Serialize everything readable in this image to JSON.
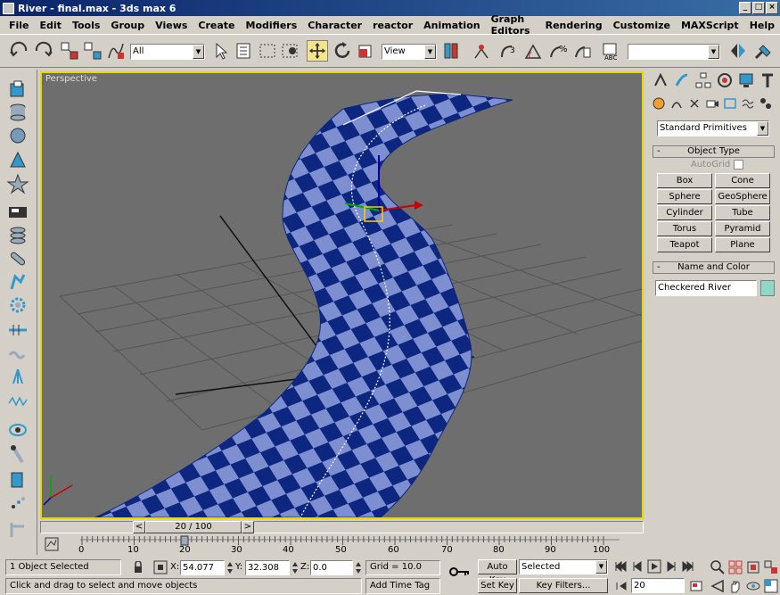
{
  "window": {
    "title": "River - final.max - 3ds max 6"
  },
  "menu": [
    "File",
    "Edit",
    "Tools",
    "Group",
    "Views",
    "Create",
    "Modifiers",
    "Character",
    "reactor",
    "Animation",
    "Graph Editors",
    "Rendering",
    "Customize",
    "MAXScript",
    "Help"
  ],
  "toolbar": {
    "selection_filter": "All",
    "ref_coord": "View",
    "named_selection": ""
  },
  "viewport": {
    "label": "Perspective"
  },
  "command_panel": {
    "category_dropdown": "Standard Primitives",
    "object_type": {
      "header": "Object Type",
      "autogrid_label": "AutoGrid",
      "buttons": [
        "Box",
        "Cone",
        "Sphere",
        "GeoSphere",
        "Cylinder",
        "Tube",
        "Torus",
        "Pyramid",
        "Teapot",
        "Plane"
      ]
    },
    "name_color": {
      "header": "Name and Color",
      "object_name": "Checkered River",
      "object_color": "#8fd8c8"
    }
  },
  "time_slider": {
    "label": "20 / 100",
    "frame": 20,
    "max": 100
  },
  "trackbar": {
    "ticks": [
      "0",
      "10",
      "20",
      "30",
      "40",
      "50",
      "60",
      "70",
      "80",
      "90",
      "100"
    ]
  },
  "status": {
    "selection": "1 Object Selected",
    "prompt": "Click and drag to select and move objects",
    "x_label": "X:",
    "x_value": "54.077",
    "y_label": "Y:",
    "y_value": "32.308",
    "z_label": "Z:",
    "z_value": "0.0",
    "grid": "Grid = 10.0",
    "add_time_tag": "Add Time Tag",
    "auto_key": "Auto Key",
    "set_key": "Set Key",
    "key_mode": "Selected",
    "key_filters": "Key Filters...",
    "current_frame": "20"
  },
  "colors": {
    "viewport_bg": "#6e6e6e",
    "active_border": "#e8d800",
    "checker_dark": "#0d2680",
    "checker_light": "#7d8fd0",
    "title_bg": "#0a246a"
  }
}
